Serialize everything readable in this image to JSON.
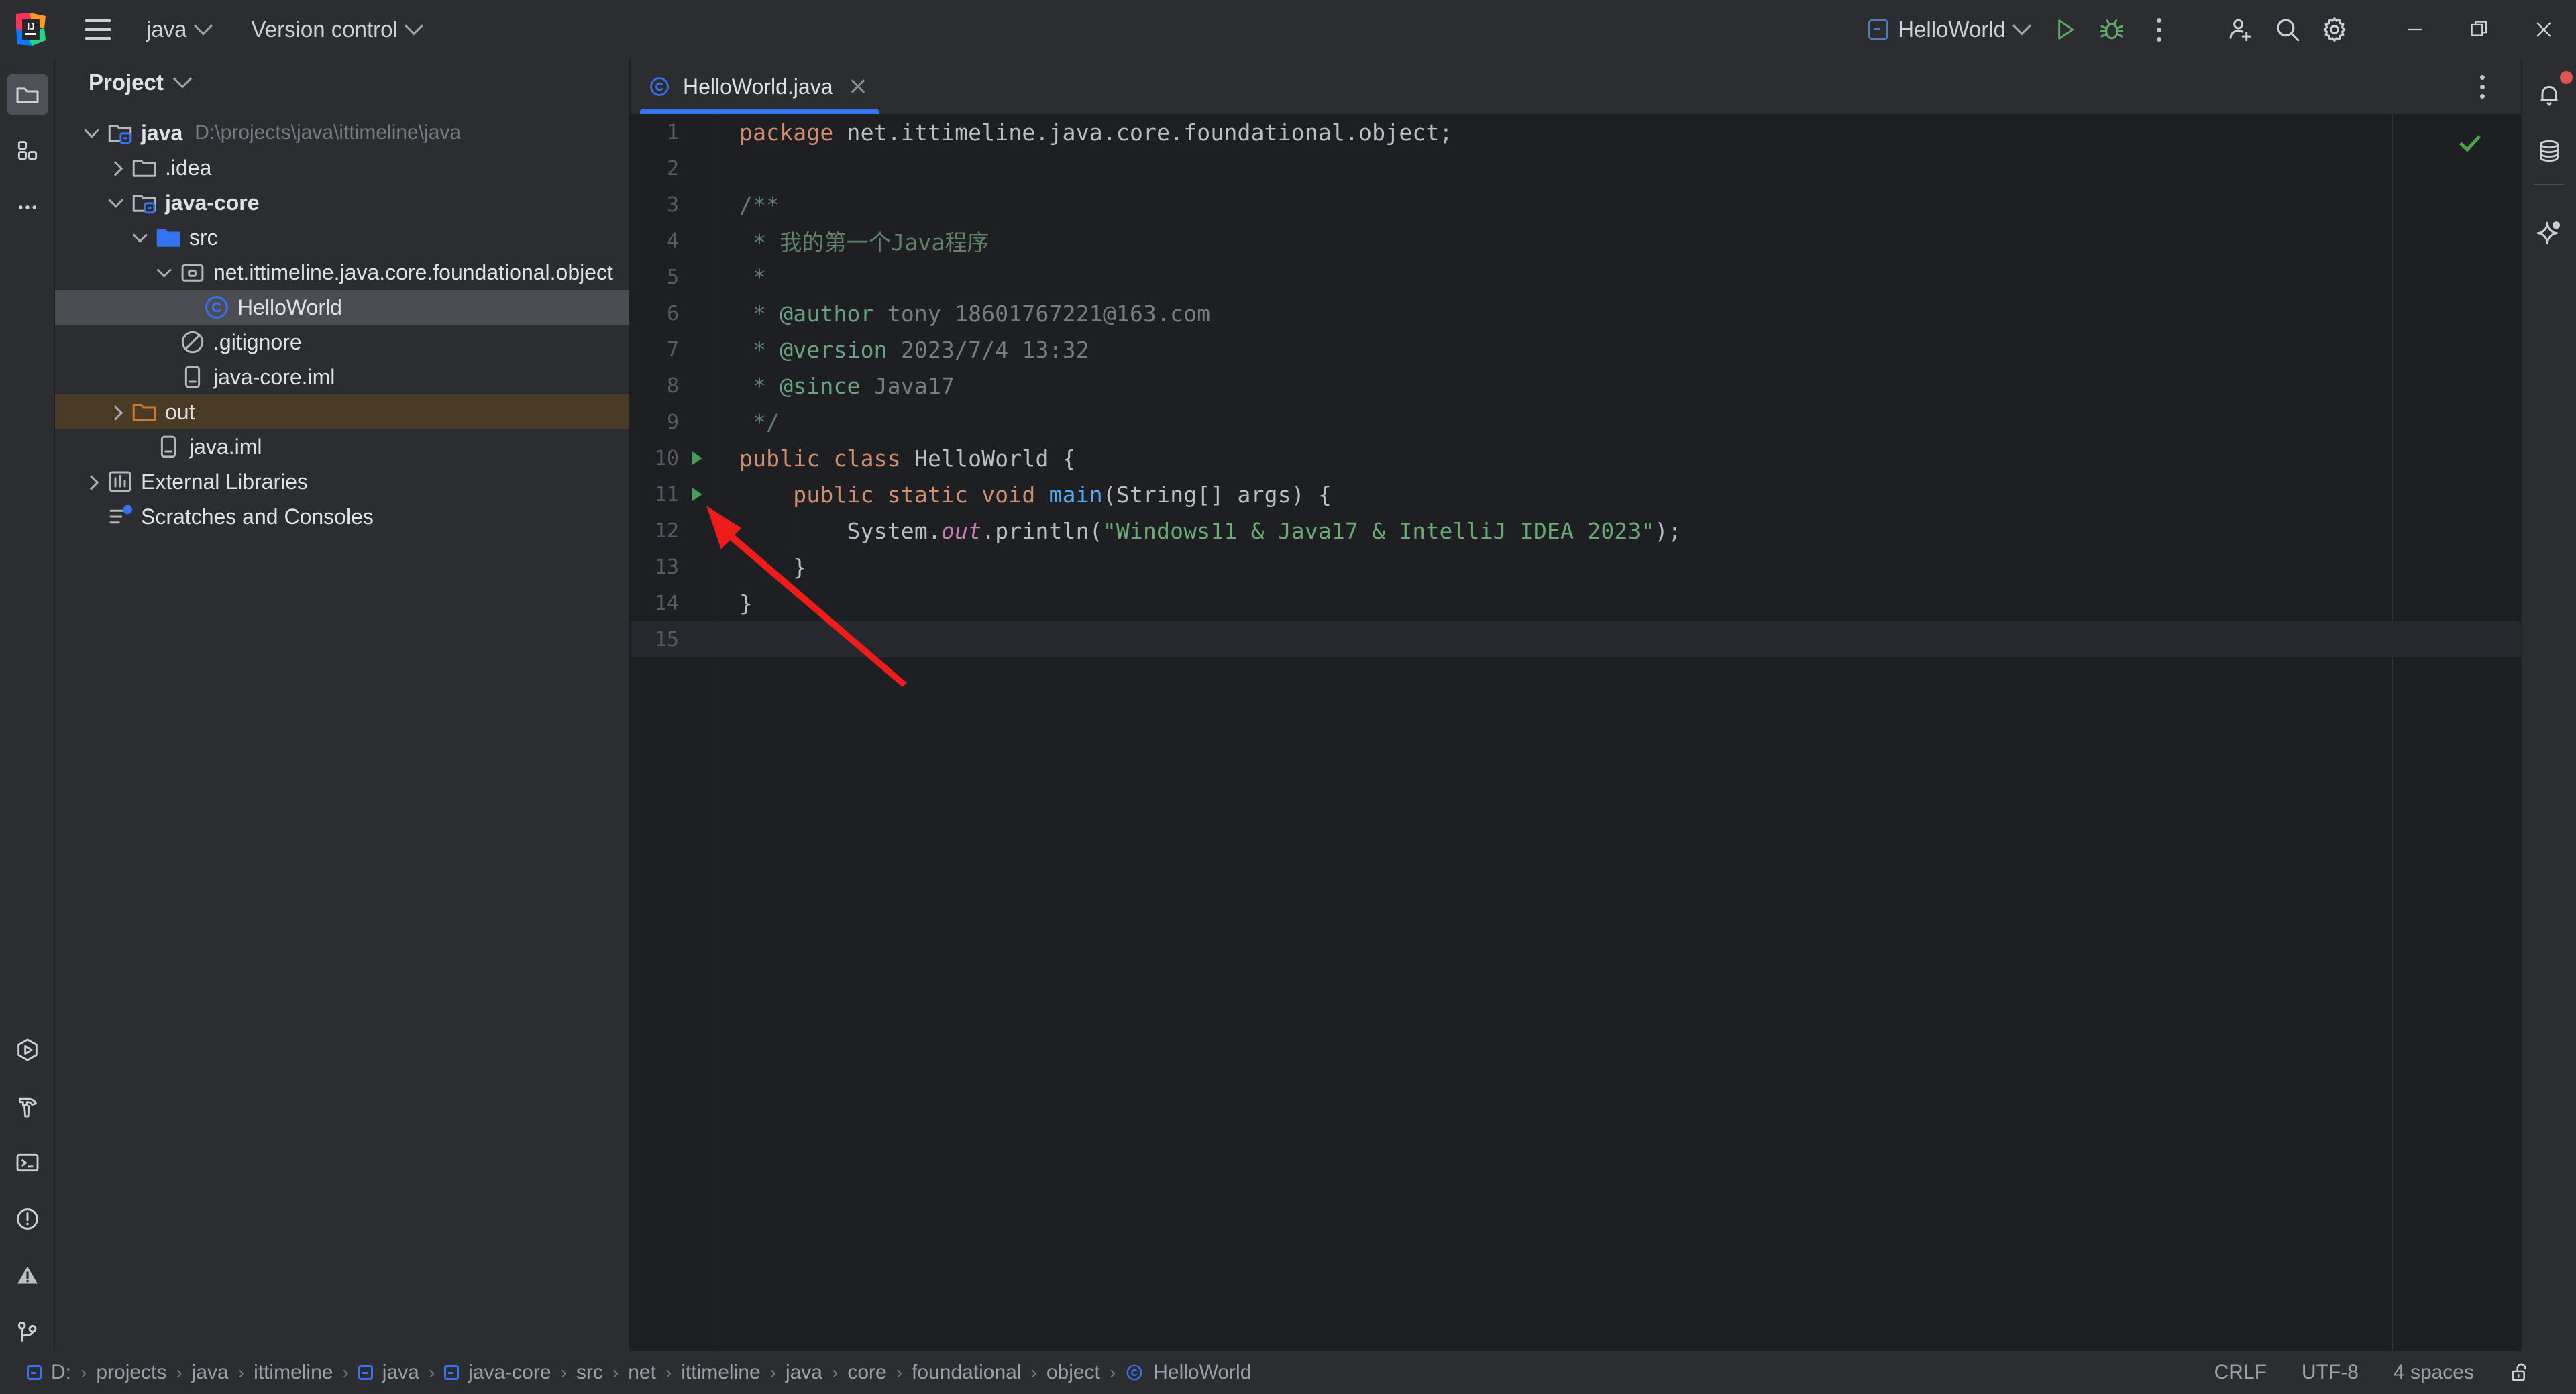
{
  "titlebar": {
    "logo_icon": "intellij-idea-logo",
    "menu_icon": "hamburger-menu-icon",
    "project_name": "java",
    "vcs_label": "Version control",
    "run_config": "HelloWorld",
    "run_icon": "run-icon",
    "debug_icon": "debug-icon",
    "more_icon": "more-options-icon",
    "add_user_icon": "add-user-icon",
    "search_icon": "search-icon",
    "settings_icon": "gear-icon",
    "minimize_icon": "minimize-icon",
    "maximize_icon": "maximize-icon",
    "close_icon": "close-icon"
  },
  "left_strip": {
    "top": [
      {
        "name": "project-tool-window",
        "icon": "folder-icon",
        "active": true
      },
      {
        "name": "structure-tool-window",
        "icon": "blocks-icon",
        "active": false
      },
      {
        "name": "more-tool-windows",
        "icon": "ellipsis-icon",
        "active": false
      }
    ],
    "bottom": [
      {
        "name": "run-tool-window",
        "icon": "run-hexagon-icon"
      },
      {
        "name": "build-tool-window",
        "icon": "hammer-icon"
      },
      {
        "name": "terminal-tool-window",
        "icon": "terminal-icon"
      },
      {
        "name": "problems-tool-window",
        "icon": "exclamation-circle-icon"
      },
      {
        "name": "warnings-tool-window",
        "icon": "warning-triangle-icon"
      },
      {
        "name": "git-tool-window",
        "icon": "git-branch-icon"
      }
    ]
  },
  "right_strip": [
    {
      "name": "notifications",
      "icon": "bell-icon",
      "badge": true
    },
    {
      "name": "database",
      "icon": "database-icon",
      "badge": false
    },
    {
      "name": "ai-assistant",
      "icon": "sparkle-icon",
      "badge": false
    }
  ],
  "project_panel": {
    "title": "Project",
    "tree": [
      {
        "label": "java",
        "path": "D:\\projects\\java\\ittimeline\\java",
        "icon": "module-folder-icon",
        "depth": 0,
        "twist": "down",
        "bold": true,
        "state": "normal"
      },
      {
        "label": ".idea",
        "path": "",
        "icon": "folder-icon",
        "depth": 1,
        "twist": "right",
        "bold": false,
        "state": "normal"
      },
      {
        "label": "java-core",
        "path": "",
        "icon": "module-folder-icon",
        "depth": 1,
        "twist": "down",
        "bold": true,
        "state": "normal"
      },
      {
        "label": "src",
        "path": "",
        "icon": "source-folder-icon",
        "depth": 2,
        "twist": "down",
        "bold": false,
        "state": "normal"
      },
      {
        "label": "net.ittimeline.java.core.foundational.object",
        "path": "",
        "icon": "package-icon",
        "depth": 3,
        "twist": "down",
        "bold": false,
        "state": "normal"
      },
      {
        "label": "HelloWorld",
        "path": "",
        "icon": "java-class-icon",
        "depth": 4,
        "twist": "none",
        "bold": false,
        "state": "selected"
      },
      {
        "label": ".gitignore",
        "path": "",
        "icon": "gitignore-icon",
        "depth": 3,
        "twist": "none",
        "bold": false,
        "state": "normal"
      },
      {
        "label": "java-core.iml",
        "path": "",
        "icon": "iml-file-icon",
        "depth": 3,
        "twist": "none",
        "bold": false,
        "state": "normal"
      },
      {
        "label": "out",
        "path": "",
        "icon": "excluded-folder-icon",
        "depth": 1,
        "twist": "right",
        "bold": false,
        "state": "excluded"
      },
      {
        "label": "java.iml",
        "path": "",
        "icon": "iml-file-icon",
        "depth": 2,
        "twist": "none",
        "bold": false,
        "state": "normal"
      },
      {
        "label": "External Libraries",
        "path": "",
        "icon": "libraries-icon",
        "depth": 0,
        "twist": "right",
        "bold": false,
        "state": "normal"
      },
      {
        "label": "Scratches and Consoles",
        "path": "",
        "icon": "scratches-icon",
        "depth": 0,
        "twist": "none",
        "bold": false,
        "state": "normal"
      }
    ]
  },
  "editor": {
    "tab": {
      "label": "HelloWorld.java",
      "icon": "java-class-icon",
      "close_icon": "close-icon",
      "active": true
    },
    "options_icon": "more-options-icon",
    "inspection_status_icon": "check-mark-icon",
    "caret_line": 15,
    "lines": [
      {
        "no": 1,
        "run": false,
        "tokens": [
          {
            "t": "package ",
            "c": "kw"
          },
          {
            "t": "net.ittimeline.java.core.foundational.object;",
            "c": ""
          }
        ]
      },
      {
        "no": 2,
        "run": false,
        "tokens": []
      },
      {
        "no": 3,
        "run": false,
        "tokens": [
          {
            "t": "/**",
            "c": "doc"
          }
        ]
      },
      {
        "no": 4,
        "run": false,
        "tokens": [
          {
            "t": " * 我的第一个Java程序",
            "c": "doc"
          }
        ]
      },
      {
        "no": 5,
        "run": false,
        "tokens": [
          {
            "t": " *",
            "c": "doc"
          }
        ]
      },
      {
        "no": 6,
        "run": false,
        "tokens": [
          {
            "t": " * ",
            "c": "doc"
          },
          {
            "t": "@author",
            "c": "doctag"
          },
          {
            "t": " tony 18601767221@163.com",
            "c": "docval"
          }
        ]
      },
      {
        "no": 7,
        "run": false,
        "tokens": [
          {
            "t": " * ",
            "c": "doc"
          },
          {
            "t": "@version",
            "c": "doctag"
          },
          {
            "t": " 2023/7/4 13:32",
            "c": "docval"
          }
        ]
      },
      {
        "no": 8,
        "run": false,
        "tokens": [
          {
            "t": " * ",
            "c": "doc"
          },
          {
            "t": "@since",
            "c": "doctag"
          },
          {
            "t": " Java17",
            "c": "docval"
          }
        ]
      },
      {
        "no": 9,
        "run": false,
        "tokens": [
          {
            "t": " */",
            "c": "doc"
          }
        ]
      },
      {
        "no": 10,
        "run": true,
        "tokens": [
          {
            "t": "public class ",
            "c": "kw"
          },
          {
            "t": "HelloWorld {",
            "c": ""
          }
        ]
      },
      {
        "no": 11,
        "run": true,
        "tokens": [
          {
            "t": "    ",
            "c": ""
          },
          {
            "t": "public static void ",
            "c": "kw"
          },
          {
            "t": "main",
            "c": "mth"
          },
          {
            "t": "(String[] args) {",
            "c": ""
          }
        ]
      },
      {
        "no": 12,
        "run": false,
        "tokens": [
          {
            "t": "        System.",
            "c": ""
          },
          {
            "t": "out",
            "c": "stat"
          },
          {
            "t": ".println(",
            "c": ""
          },
          {
            "t": "\"Windows11 & Java17 & IntelliJ IDEA 2023\"",
            "c": "str"
          },
          {
            "t": ");",
            "c": ""
          }
        ]
      },
      {
        "no": 13,
        "run": false,
        "tokens": [
          {
            "t": "    }",
            "c": ""
          }
        ]
      },
      {
        "no": 14,
        "run": false,
        "tokens": [
          {
            "t": "}",
            "c": ""
          }
        ]
      },
      {
        "no": 15,
        "run": false,
        "tokens": []
      }
    ]
  },
  "annotation": {
    "type": "red-arrow",
    "points_to": "run-gutter-icon-line-11",
    "color": "#f01c1c"
  },
  "statusbar": {
    "breadcrumb": [
      {
        "label": "D:",
        "icon": "drive-icon"
      },
      {
        "label": "projects",
        "icon": ""
      },
      {
        "label": "java",
        "icon": ""
      },
      {
        "label": "ittimeline",
        "icon": ""
      },
      {
        "label": "java",
        "icon": "module-icon"
      },
      {
        "label": "java-core",
        "icon": "module-icon"
      },
      {
        "label": "src",
        "icon": ""
      },
      {
        "label": "net",
        "icon": ""
      },
      {
        "label": "ittimeline",
        "icon": ""
      },
      {
        "label": "java",
        "icon": ""
      },
      {
        "label": "core",
        "icon": ""
      },
      {
        "label": "foundational",
        "icon": ""
      },
      {
        "label": "object",
        "icon": ""
      },
      {
        "label": "HelloWorld",
        "icon": "java-class-icon"
      }
    ],
    "separator": "›",
    "line_separator": "CRLF",
    "encoding": "UTF-8",
    "indent": "4 spaces",
    "lock_icon": "unlocked-padlock-icon"
  }
}
